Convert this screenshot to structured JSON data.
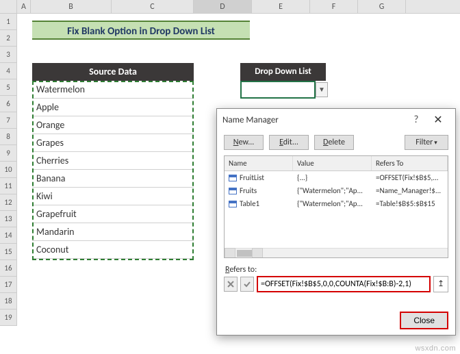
{
  "columns": [
    "A",
    "B",
    "C",
    "D",
    "E",
    "F",
    "G"
  ],
  "selected_column": "D",
  "row_count": 19,
  "title_banner": "Fix Blank Option in Drop Down List",
  "source_header": "Source Data",
  "dropdown_header": "Drop Down List",
  "source_items": [
    "Watermelon",
    "Apple",
    "Orange",
    "Grapes",
    "Cherries",
    "Banana",
    "Kiwi",
    "Grapefruit",
    "Mandarin",
    "Coconut"
  ],
  "dropdown_value": "",
  "dialog": {
    "title": "Name Manager",
    "help_glyph": "?",
    "close_glyph": "✕",
    "buttons": {
      "new": "New...",
      "edit": "Edit...",
      "delete": "Delete",
      "filter": "Filter"
    },
    "filter_arrow": "▾",
    "columns": {
      "name": "Name",
      "value": "Value",
      "refers": "Refers To"
    },
    "rows": [
      {
        "name": "FruitList",
        "value": "{...}",
        "refers": "=OFFSET(Fix!$B$5,..."
      },
      {
        "name": "Fruits",
        "value": "{\"Watermelon\";\"Ap...",
        "refers": "=Name_Manager!$..."
      },
      {
        "name": "Table1",
        "value": "{\"Watermelon\";\"Ap...",
        "refers": "=Table!$B$5:$B$15"
      }
    ],
    "refers_label": "Refers to:",
    "refers_value": "=OFFSET(Fix!$B$5,0,0,COUNTA(Fix!$B:B)-2,1)",
    "pick_glyph": "↥",
    "close_btn": "Close"
  },
  "watermark": "wsxdn.com"
}
